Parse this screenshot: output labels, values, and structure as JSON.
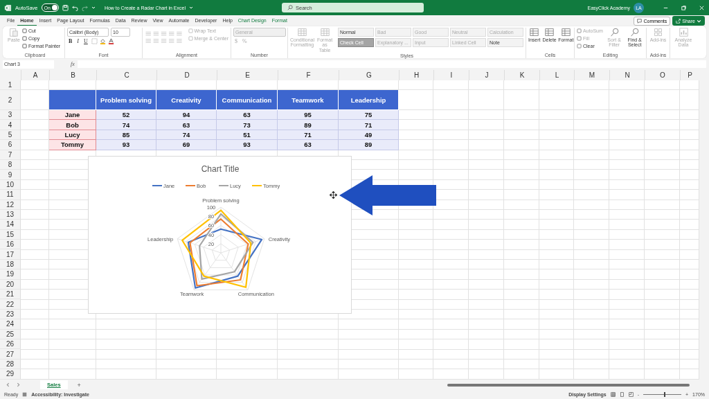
{
  "title_bar": {
    "autosave_label": "AutoSave",
    "autosave": {
      "label": "On",
      "on": true
    },
    "title": "How to Create a Radar Chart in Excel",
    "search": {
      "placeholder": "Search"
    },
    "account": "EasyClick Academy",
    "avatar": "LA"
  },
  "tabs": [
    {
      "label": "File",
      "selected": false,
      "kind": "standard"
    },
    {
      "label": "Home",
      "selected": true,
      "kind": "standard"
    },
    {
      "label": "Insert",
      "selected": false,
      "kind": "standard"
    },
    {
      "label": "Page Layout",
      "selected": false,
      "kind": "standard"
    },
    {
      "label": "Formulas",
      "selected": false,
      "kind": "standard"
    },
    {
      "label": "Data",
      "selected": false,
      "kind": "standard"
    },
    {
      "label": "Review",
      "selected": false,
      "kind": "standard"
    },
    {
      "label": "View",
      "selected": false,
      "kind": "standard"
    },
    {
      "label": "Automate",
      "selected": false,
      "kind": "standard"
    },
    {
      "label": "Developer",
      "selected": false,
      "kind": "standard"
    },
    {
      "label": "Help",
      "selected": false,
      "kind": "standard"
    },
    {
      "label": "Chart Design",
      "selected": false,
      "kind": "contextual"
    },
    {
      "label": "Format",
      "selected": false,
      "kind": "contextual"
    }
  ],
  "comments": "Comments",
  "share": "Share",
  "ribbon": {
    "clipboard": {
      "label": "Clipboard",
      "paste": {
        "label": "Paste",
        "disabled": true
      },
      "items": [
        {
          "label": "Cut",
          "disabled": false
        },
        {
          "label": "Copy",
          "disabled": false
        },
        {
          "label": "Format Painter",
          "disabled": false
        }
      ]
    },
    "font": {
      "label": "Font",
      "font_name": "Calibri (Body)",
      "font_size": "10",
      "buttons": [
        "B",
        "I",
        "U"
      ]
    },
    "alignment": {
      "label": "Alignment",
      "items": [
        {
          "label": "Wrap Text",
          "disabled": true
        },
        {
          "label": "Merge & Center",
          "disabled": true
        }
      ]
    },
    "number": {
      "label": "Number",
      "format": {
        "value": "General",
        "disabled": true
      },
      "buttons": [
        "$",
        "%"
      ]
    },
    "styles": {
      "label": "Styles",
      "large": [
        {
          "label": "Conditional Formatting",
          "disabled": true
        },
        {
          "label": "Format as Table",
          "disabled": true
        }
      ],
      "cells": [
        {
          "label": "Normal",
          "kind": "plain",
          "disabled": false
        },
        {
          "label": "Bad",
          "kind": "plain",
          "disabled": true
        },
        {
          "label": "Good",
          "kind": "plain",
          "disabled": true
        },
        {
          "label": "Neutral",
          "kind": "plain",
          "disabled": true
        },
        {
          "label": "Calculation",
          "kind": "plain",
          "disabled": true
        },
        {
          "label": "Check Cell",
          "kind": "check",
          "disabled": false
        },
        {
          "label": "Explanatory ...",
          "kind": "plain",
          "disabled": true
        },
        {
          "label": "Input",
          "kind": "plain",
          "disabled": true
        },
        {
          "label": "Linked Cell",
          "kind": "plain",
          "disabled": true
        },
        {
          "label": "Note",
          "kind": "plain",
          "disabled": false
        }
      ]
    },
    "cells": {
      "label": "Cells",
      "items": [
        {
          "label": "Insert",
          "disabled": false
        },
        {
          "label": "Delete",
          "disabled": false
        },
        {
          "label": "Format",
          "disabled": false
        }
      ]
    },
    "editing": {
      "label": "Editing",
      "small": [
        {
          "label": "AutoSum",
          "disabled": true
        },
        {
          "label": "Fill",
          "disabled": true
        },
        {
          "label": "Clear",
          "disabled": false
        }
      ],
      "large": [
        {
          "label": "Sort & Filter",
          "disabled": true
        },
        {
          "label": "Find & Select",
          "disabled": false
        }
      ]
    },
    "addins": {
      "label": "Add-ins",
      "items": [
        {
          "label": "Add-ins",
          "disabled": true
        }
      ]
    },
    "analyze": {
      "label": "Analyze Data",
      "disabled": true
    }
  },
  "formula_bar": {
    "name_box": "Chart 3",
    "function_label": "fx"
  },
  "sheet": {
    "columns": [
      "A",
      "B",
      "C",
      "D",
      "E",
      "F",
      "G",
      "H",
      "I",
      "J",
      "K",
      "L",
      "M",
      "N",
      "O",
      "P"
    ],
    "rows": [
      "1",
      "2",
      "3",
      "4",
      "5",
      "6",
      "7",
      "8",
      "9",
      "10",
      "11",
      "12",
      "13",
      "14",
      "15",
      "16",
      "17",
      "18",
      "19",
      "20",
      "21",
      "22",
      "23",
      "24",
      "25",
      "26",
      "27",
      "28",
      "29"
    ],
    "table": {
      "header": [
        "Problem solving",
        "Creativity",
        "Communication",
        "Teamwork",
        "Leadership"
      ],
      "rows": [
        {
          "name": "Jane",
          "values": [
            "52",
            "94",
            "63",
            "95",
            "75"
          ]
        },
        {
          "name": "Bob",
          "values": [
            "74",
            "63",
            "73",
            "89",
            "71"
          ]
        },
        {
          "name": "Lucy",
          "values": [
            "85",
            "74",
            "51",
            "71",
            "49"
          ]
        },
        {
          "name": "Tommy",
          "values": [
            "93",
            "69",
            "93",
            "63",
            "89"
          ]
        }
      ]
    }
  },
  "chart": {
    "chart_data": {
      "type": "radar",
      "title": "Chart Title",
      "categories": [
        "Problem solving",
        "Creativity",
        "Communication",
        "Teamwork",
        "Leadership"
      ],
      "series": [
        {
          "name": "Jane",
          "color": "#4472c4",
          "values": [
            52,
            94,
            63,
            95,
            75
          ]
        },
        {
          "name": "Bob",
          "color": "#ed7d31",
          "values": [
            74,
            63,
            73,
            89,
            71
          ]
        },
        {
          "name": "Lucy",
          "color": "#a5a5a5",
          "values": [
            85,
            74,
            51,
            71,
            49
          ]
        },
        {
          "name": "Tommy",
          "color": "#ffc000",
          "values": [
            93,
            69,
            93,
            63,
            89
          ]
        }
      ],
      "ylim": [
        0,
        100
      ],
      "yticks": [
        20,
        40,
        60,
        80,
        100
      ],
      "legend": "top"
    }
  },
  "sheet_tabs": [
    {
      "label": "Sales",
      "selected": true
    }
  ],
  "add_sheet": "+",
  "status_bar": {
    "ready": "Ready",
    "accessibility": "Accessibility: Investigate",
    "display_settings": "Display Settings",
    "zoom_out": "-",
    "zoom_in": "+",
    "zoom": {
      "level": 0.55,
      "reading": "170%"
    }
  }
}
